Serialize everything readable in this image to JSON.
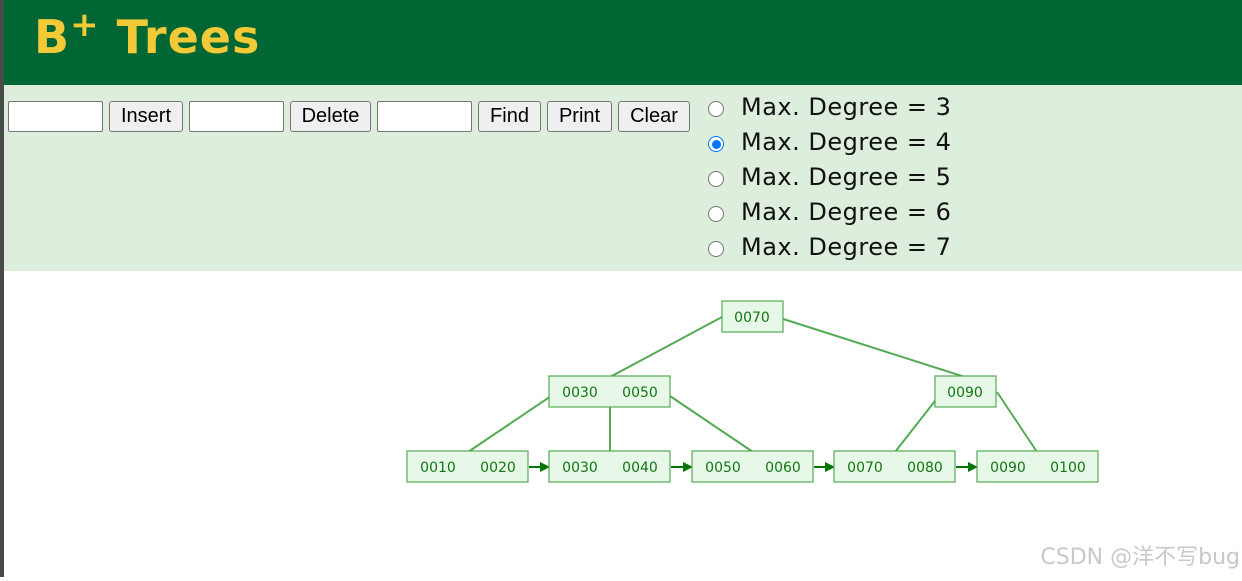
{
  "header": {
    "title": "B",
    "title_sup": "+",
    "title_rest": "Trees"
  },
  "toolbar": {
    "insert_label": "Insert",
    "delete_label": "Delete",
    "find_label": "Find",
    "print_label": "Print",
    "clear_label": "Clear",
    "insert_value": "",
    "delete_value": "",
    "find_value": ""
  },
  "degree_options": [
    {
      "label": "Max. Degree = 3",
      "checked": false
    },
    {
      "label": "Max. Degree = 4",
      "checked": true
    },
    {
      "label": "Max. Degree = 5",
      "checked": false
    },
    {
      "label": "Max. Degree = 6",
      "checked": false
    },
    {
      "label": "Max. Degree = 7",
      "checked": false
    }
  ],
  "tree": {
    "root": {
      "keys": [
        "0070"
      ]
    },
    "level1": [
      {
        "keys": [
          "0030",
          "0050"
        ]
      },
      {
        "keys": [
          "0090"
        ]
      }
    ],
    "leaves": [
      {
        "keys": [
          "0010",
          "0020"
        ]
      },
      {
        "keys": [
          "0030",
          "0040"
        ]
      },
      {
        "keys": [
          "0050",
          "0060"
        ]
      },
      {
        "keys": [
          "0070",
          "0080"
        ]
      },
      {
        "keys": [
          "0090",
          "0100"
        ]
      }
    ]
  },
  "colors": {
    "header_bg": "#006633",
    "title": "#f2c937",
    "toolbar_bg": "#ddeedd",
    "node_stroke": "#55aa55",
    "node_fill": "#e8f8e8",
    "node_text": "#117711",
    "arrow": "#007700"
  },
  "watermark": "CSDN @洋不写bug"
}
